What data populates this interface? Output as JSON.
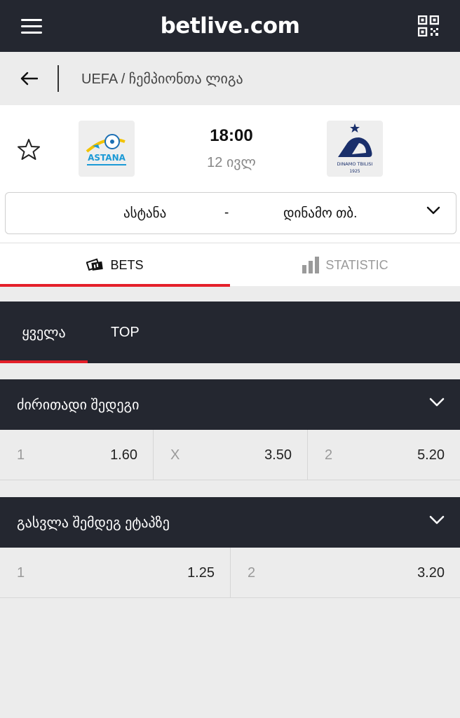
{
  "header": {
    "brand": "betlive.com"
  },
  "breadcrumb": {
    "text": "UEFA / ჩემპიონთა ლიგა"
  },
  "match": {
    "time": "18:00",
    "date": "12 ივლ",
    "home_team": "ასტანა",
    "separator": "-",
    "away_team": "დინამო თბ.",
    "home_logo_text": "ASTANA",
    "away_logo_text": "DINAMO TBILISI",
    "away_logo_year": "1925"
  },
  "tabs": [
    {
      "label": "BETS",
      "active": true
    },
    {
      "label": "STATISTIC",
      "active": false
    }
  ],
  "filters": [
    {
      "label": "ყველა",
      "active": true
    },
    {
      "label": "TOP",
      "active": false
    }
  ],
  "markets": [
    {
      "title": "ძირითადი შედეგი",
      "odds": [
        {
          "label": "1",
          "value": "1.60"
        },
        {
          "label": "X",
          "value": "3.50"
        },
        {
          "label": "2",
          "value": "5.20"
        }
      ]
    },
    {
      "title": "გასვლა შემდეგ ეტაპზე",
      "odds": [
        {
          "label": "1",
          "value": "1.25"
        },
        {
          "label": "2",
          "value": "3.20"
        }
      ]
    }
  ],
  "colors": {
    "dark": "#242730",
    "accent": "#e4202a",
    "bg": "#ececec"
  }
}
